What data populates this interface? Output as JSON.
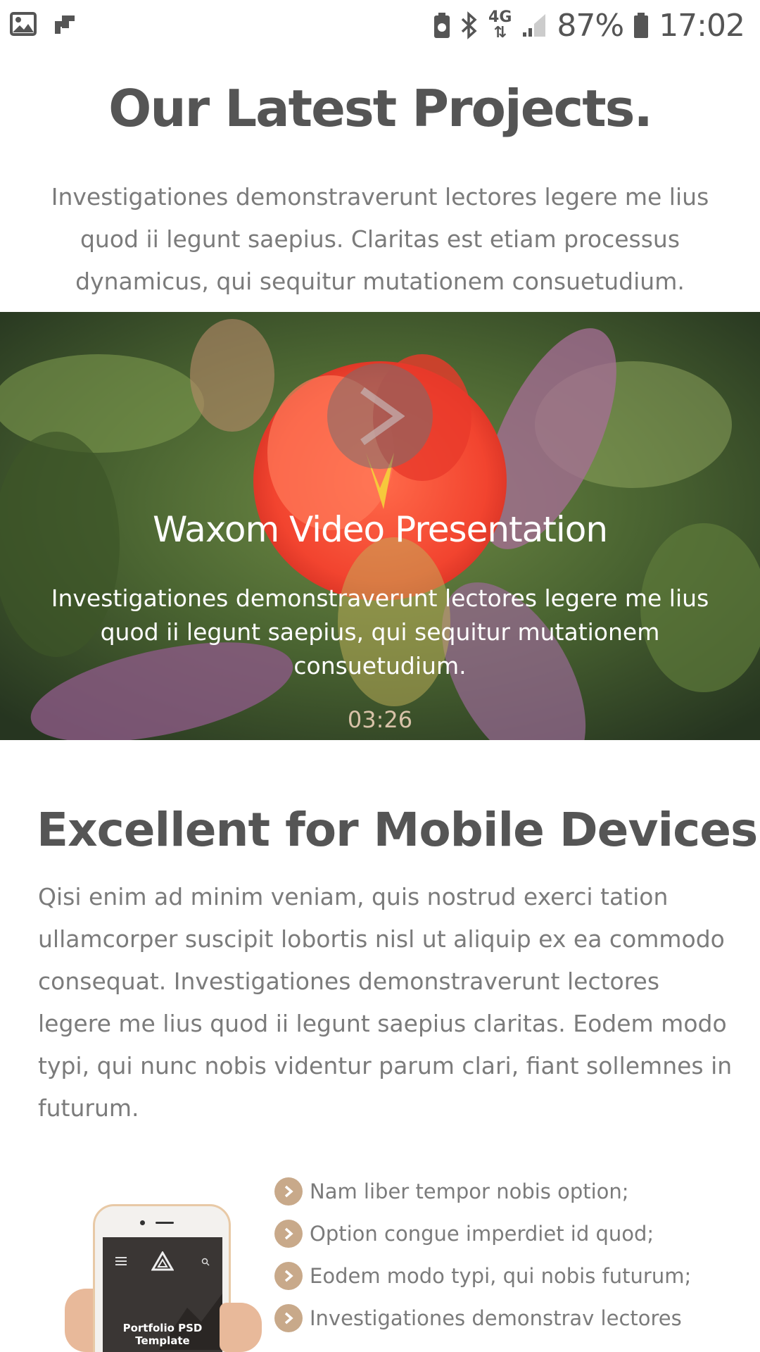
{
  "status_bar": {
    "battery_percent": "87%",
    "time": "17:02",
    "network": "4G",
    "icons": [
      "image-icon",
      "cards-icon",
      "battery-saver-icon",
      "bluetooth-icon",
      "network-4g-icon",
      "signal-icon",
      "battery-icon"
    ]
  },
  "projects": {
    "title": "Our Latest Projects.",
    "description": "Investigationes demonstraverunt lectores legere me lius quod ii legunt saepius. Claritas est etiam processus dynamicus, qui sequitur mutationem consuetudium."
  },
  "video": {
    "title": "Waxom Video Presentation",
    "description": "Investigationes demonstraverunt lectores legere me lius quod ii legunt saepius, qui sequitur mutationem consuetudium.",
    "duration": "03:26"
  },
  "mobile": {
    "title": "Excellent for Mobile Devices.",
    "description": "Qisi enim ad minim veniam, quis nostrud exerci tation ullamcorper suscipit lobortis nisl ut aliquip ex ea commodo consequat. Investigationes demonstraverunt lectores legere me lius quod ii legunt saepius claritas. Eodem modo typi, qui nunc nobis videntur parum clari, fiant sollemnes in futurum.",
    "features": [
      "Nam liber tempor nobis option;",
      "Option congue imperdiet id quod;",
      "Eodem modo typi, qui nobis futurum;",
      "Investigationes demonstrav lectores"
    ],
    "phone_screen_title": "Portfolio PSD Template"
  },
  "colors": {
    "accent": "#c8a98a",
    "heading": "#555555",
    "body_text": "#7b7b7b",
    "video_time": "#d8c2a8"
  }
}
